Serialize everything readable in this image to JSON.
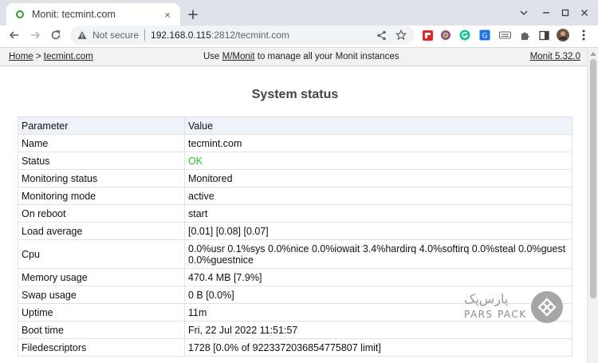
{
  "browser": {
    "tab_title": "Monit: tecmint.com",
    "tab_close": "×",
    "new_tab": "+",
    "security_label": "Not secure",
    "url_host": "192.168.0.115",
    "url_rest": ":2812/tecmint.com"
  },
  "monit_header": {
    "home_link": "Home",
    "breadcrumb_sep": " > ",
    "host_link": "tecmint.com",
    "center_prefix": "Use ",
    "mmonit_link": "M/Monit",
    "center_suffix": " to manage all your Monit instances",
    "version_link": "Monit 5.32.0"
  },
  "page_title": "System status",
  "table": {
    "columns": [
      "Parameter",
      "Value"
    ],
    "rows": [
      {
        "param": "Name",
        "value": "tecmint.com"
      },
      {
        "param": "Status",
        "value": "OK"
      },
      {
        "param": "Monitoring status",
        "value": "Monitored"
      },
      {
        "param": "Monitoring mode",
        "value": "active"
      },
      {
        "param": "On reboot",
        "value": "start"
      },
      {
        "param": "Load average",
        "value": "[0.01] [0.08] [0.07]"
      },
      {
        "param": "Cpu",
        "value_line1": "0.0%usr 0.1%sys 0.0%nice 0.0%iowait 3.4%hardirq 4.0%softirq 0.0%steal 0.0%guest",
        "value_line2": "0.0%guestnice"
      },
      {
        "param": "Memory usage",
        "value": "470.4 MB [7.9%]"
      },
      {
        "param": "Swap usage",
        "value": "0 B [0.0%]"
      },
      {
        "param": "Uptime",
        "value": "11m"
      },
      {
        "param": "Boot time",
        "value": "Fri, 22 Jul 2022 11:51:57"
      },
      {
        "param": "Filedescriptors",
        "value": "1728 [0.0% of 9223372036854775807 limit]"
      }
    ]
  },
  "watermark": {
    "persian_text": "پارس‌پک",
    "english_text": "PARS PACK"
  },
  "colors": {
    "ok_status": "#29c129",
    "table_header_bg": "#eef3fa",
    "monit_header_bg": "#f2f2f2"
  },
  "icons": {
    "favicon": "green-dot-icon",
    "security": "warning-triangle-icon",
    "share": "share-icon",
    "bookmark": "star-icon"
  }
}
